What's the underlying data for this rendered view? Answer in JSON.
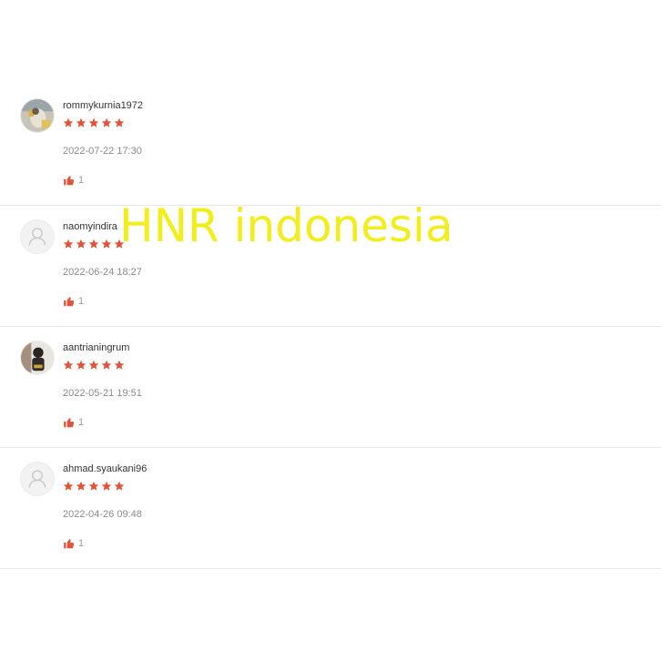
{
  "watermark": "HNR indonesia",
  "colors": {
    "star": "#e1533b",
    "thumb": "#e1533b",
    "watermark": "#f2ee1c"
  },
  "reviews": [
    {
      "username": "rommykurnia1972",
      "rating": 5,
      "timestamp": "2022-07-22 17:30",
      "likes": "1",
      "avatar": "photo"
    },
    {
      "username": "naomyindira",
      "rating": 5,
      "timestamp": "2022-06-24 18:27",
      "likes": "1",
      "avatar": "default-user-icon"
    },
    {
      "username": "aantrianingrum",
      "rating": 5,
      "timestamp": "2022-05-21 19:51",
      "likes": "1",
      "avatar": "photo"
    },
    {
      "username": "ahmad.syaukani96",
      "rating": 5,
      "timestamp": "2022-04-26 09:48",
      "likes": "1",
      "avatar": "default-user-icon"
    }
  ]
}
